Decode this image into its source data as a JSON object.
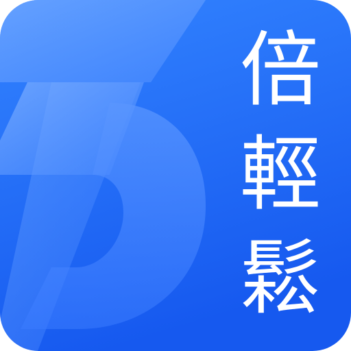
{
  "app_icon": {
    "colors": {
      "background_top": "#2f80ff",
      "background_bottom": "#1a5ff0",
      "logo_light": "#5f9bff",
      "text": "#ffffff"
    },
    "logo_icon": "stylized-number-3-icon",
    "brand_name": {
      "char_1": "倍",
      "char_2": "輕",
      "char_3": "鬆"
    }
  }
}
